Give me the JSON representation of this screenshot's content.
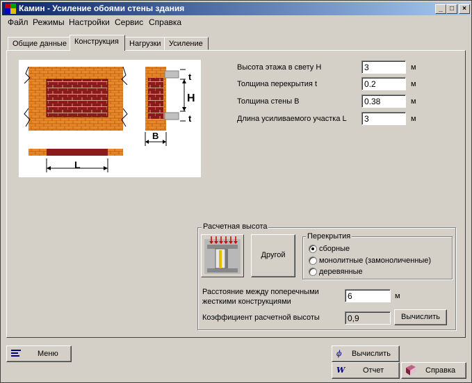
{
  "window": {
    "title": "Камин - Усиление обоями стены здания",
    "minimize": "_",
    "maximize": "□",
    "close": "×"
  },
  "menu": [
    "Файл",
    "Режимы",
    "Настройки",
    "Сервис",
    "Справка"
  ],
  "tabs": [
    {
      "label": "Общие данные",
      "active": false
    },
    {
      "label": "Конструкция",
      "active": true
    },
    {
      "label": "Нагрузки",
      "active": false
    },
    {
      "label": "Усиление",
      "active": false
    }
  ],
  "diagram": {
    "label_t_top": "t",
    "label_h": "H",
    "label_t_bottom": "t",
    "label_b": "B",
    "label_l": "L"
  },
  "fields": [
    {
      "label": "Высота этажа в свету H",
      "value": "3",
      "unit": "м"
    },
    {
      "label": "Толщина перекрытия t",
      "value": "0.2",
      "unit": "м"
    },
    {
      "label": "Толщина стены B",
      "value": "0.38",
      "unit": "м"
    },
    {
      "label": "Длина усиливаемого участка L",
      "value": "3",
      "unit": "м"
    }
  ],
  "calc_height": {
    "title": "Расчетная высота",
    "other_button": "Другой",
    "floors_group": {
      "title": "Перекрытия",
      "options": [
        {
          "label": "сборные",
          "checked": true
        },
        {
          "label": "монолитные (замоноличенные)",
          "checked": false
        },
        {
          "label": "деревянные",
          "checked": false
        }
      ]
    },
    "distance_label_1": "Расстояние между поперечными",
    "distance_label_2": "жесткими конструкциями",
    "distance_value": "6",
    "distance_unit": "м",
    "coef_label": "Коэффициент расчетной высоты",
    "coef_value": "0,9",
    "calc_button": "Вычислить"
  },
  "bottom": {
    "menu_button": "Меню",
    "calculate_button": "Вычислить",
    "report_button": "Отчет",
    "help_button": "Справка"
  },
  "colors": {
    "brick": "#8b1a1a",
    "mortar_brick": "#e8882a",
    "title_start": "#0a246a",
    "title_end": "#a6caf0"
  }
}
